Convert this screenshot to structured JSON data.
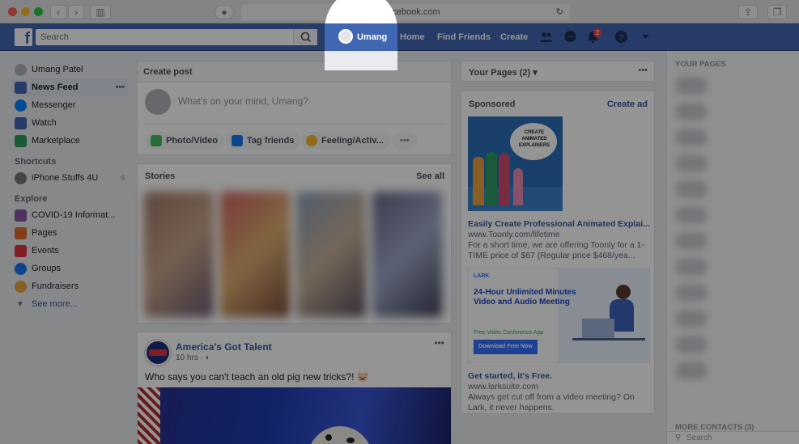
{
  "browser": {
    "url": "facebook.com",
    "back_icon": "chevron-left-icon",
    "forward_icon": "chevron-right-icon"
  },
  "topbar": {
    "search_placeholder": "Search",
    "profile_name": "Umang",
    "nav": [
      "Home",
      "Find Friends",
      "Create"
    ],
    "notification_count": "2",
    "brand_color": "#4267b2"
  },
  "leftnav": {
    "user": "Umang Patel",
    "items": [
      {
        "label": "News Feed"
      },
      {
        "label": "Messenger"
      },
      {
        "label": "Watch"
      },
      {
        "label": "Marketplace"
      }
    ],
    "shortcuts_heading": "Shortcuts",
    "shortcuts": [
      {
        "label": "iPhone Stuffs 4U"
      }
    ],
    "explore_heading": "Explore",
    "explore": [
      {
        "label": "COVID-19 Informat..."
      },
      {
        "label": "Pages"
      },
      {
        "label": "Events"
      },
      {
        "label": "Groups"
      },
      {
        "label": "Fundraisers"
      }
    ],
    "see_more": "See more..."
  },
  "composer": {
    "title": "Create post",
    "placeholder": "What's on your mind, Umang?",
    "actions": [
      "Photo/Video",
      "Tag friends",
      "Feeling/Activ..."
    ],
    "more": "•••"
  },
  "stories": {
    "title": "Stories",
    "see_all": "See all"
  },
  "post": {
    "author": "America's Got Talent",
    "time": "10 hrs",
    "text": "Who says you can't teach an old pig new tricks?! 🐷"
  },
  "rightcol": {
    "pages_label": "Your Pages (2)",
    "sponsored": "Sponsored",
    "create_ad": "Create ad",
    "ad1": {
      "image_text": "CREATE ANIMATED EXPLAINERS",
      "title": "Easily Create Professional Animated Explai...",
      "url": "www.Toonly.com/lifetime",
      "desc": "For a short time, we are offering Toonly for a 1-TIME price of $67 (Regular price $468/yea..."
    },
    "ad2": {
      "brand": "LARK",
      "headline": "24-Hour Unlimited Minutes Video and Audio Meeting",
      "subline": "Free Video Conference App",
      "button": "Download Free Now",
      "title": "Get started, it's Free.",
      "url": "www.larksuite.com",
      "desc": "Always get cut off from a video meeting? On Lark, it never happens."
    }
  },
  "sidebar": {
    "your_pages": "YOUR PAGES",
    "more_contacts": "MORE CONTACTS (3)",
    "search": "Search"
  }
}
